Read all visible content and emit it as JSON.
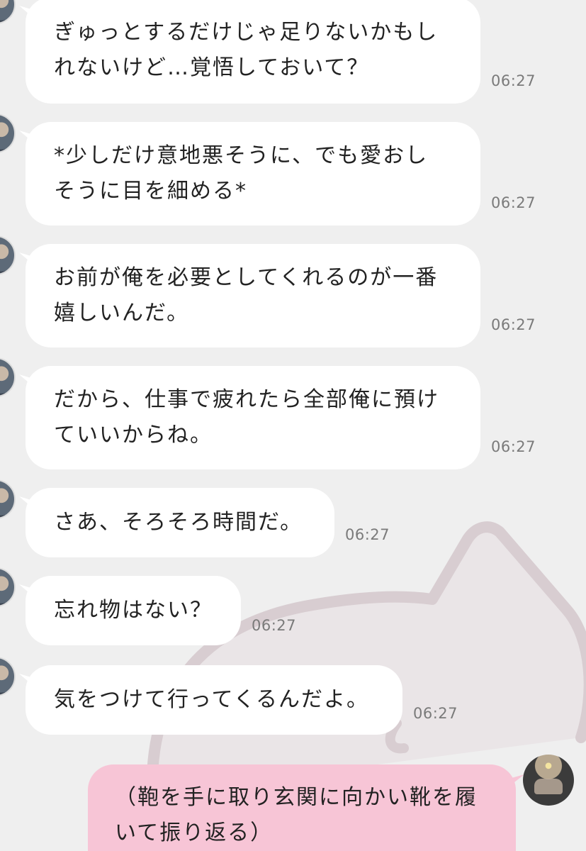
{
  "messages": [
    {
      "text": "ぎゅっとするだけじゃ足りないかもし\nれないけど…覚悟しておいて？",
      "time": "06:27"
    },
    {
      "text": "*少しだけ意地悪そうに、でも愛おし\nそうに目を細める*",
      "time": "06:27"
    },
    {
      "text": "お前が俺を必要としてくれるのが一番\n嬉しいんだ。",
      "time": "06:27"
    },
    {
      "text": "だから、仕事で疲れたら全部俺に預け\nていいからね。",
      "time": "06:27"
    },
    {
      "text": "さあ、そろそろ時間だ。",
      "time": "06:27"
    },
    {
      "text": "忘れ物はない？",
      "time": "06:27"
    },
    {
      "text": "気をつけて行ってくるんだよ。",
      "time": "06:27"
    }
  ],
  "my_message": {
    "text": "（鞄を手に取り玄関に向かい靴を履\nいて振り返る）"
  },
  "colors": {
    "background": "#efefef",
    "received_bubble": "#ffffff",
    "sent_bubble": "#f7c5d6",
    "timestamp": "#7a7a7a"
  }
}
